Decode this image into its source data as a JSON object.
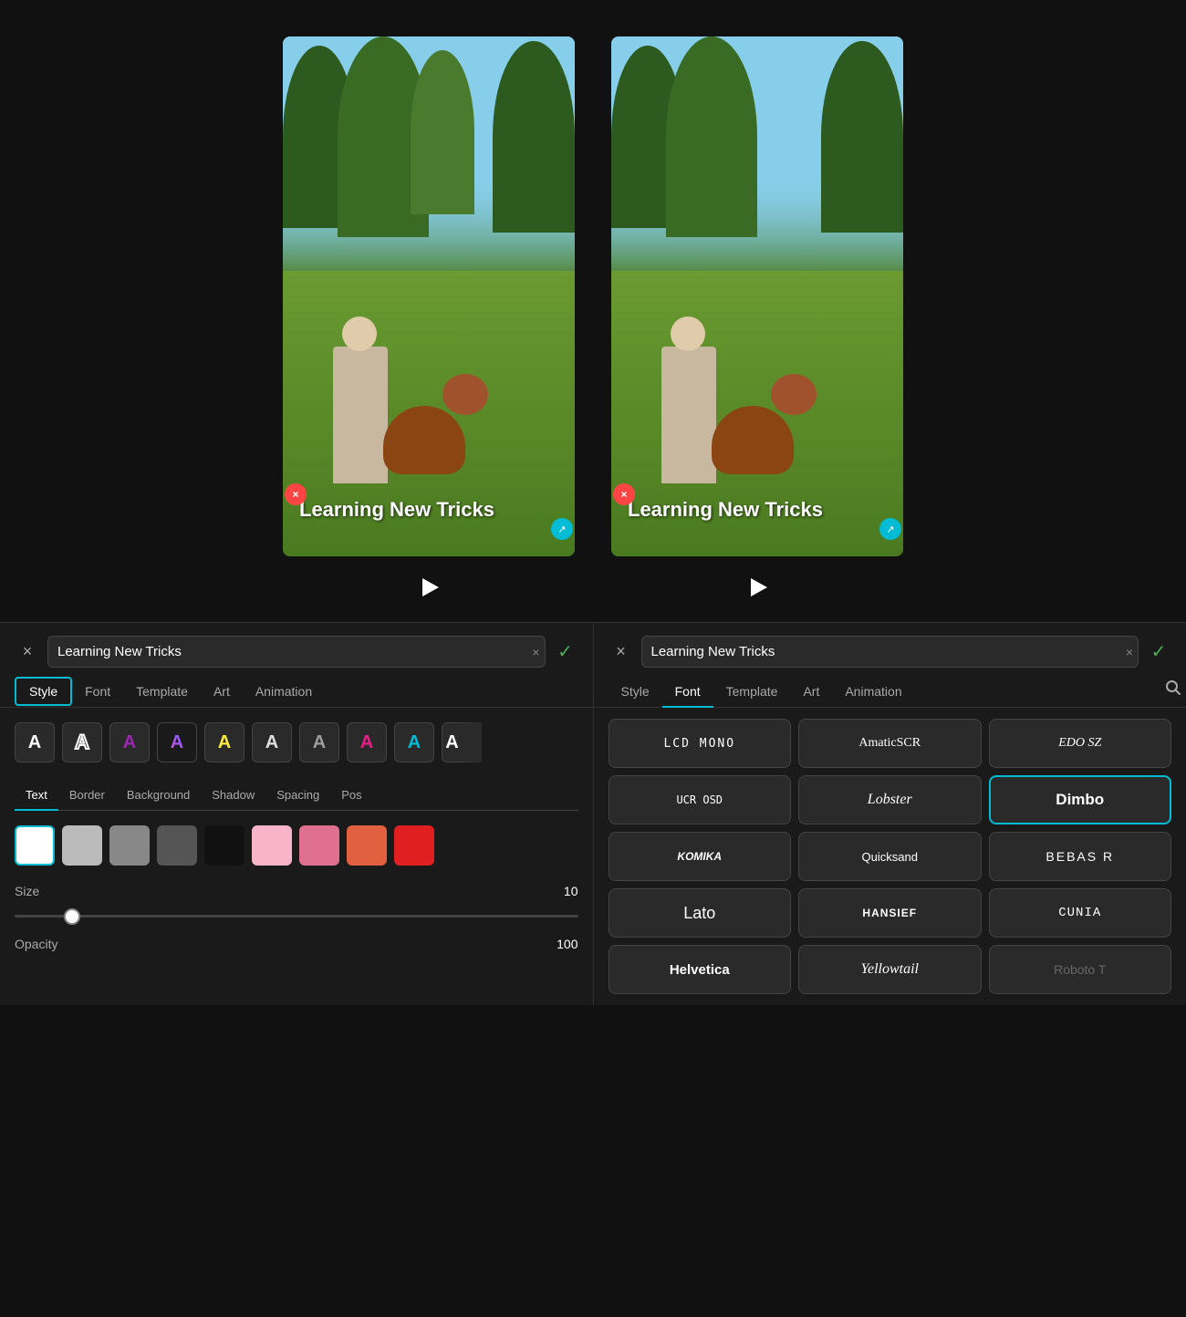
{
  "previews": [
    {
      "caption": "Learning New Tricks",
      "play_label": "play"
    },
    {
      "caption": "Learning New Tricks",
      "play_label": "play"
    }
  ],
  "left_panel": {
    "close_label": "×",
    "input_value": "Learning New Tricks",
    "input_clear": "×",
    "confirm_label": "✓",
    "tabs": [
      {
        "id": "style",
        "label": "Style",
        "active": true
      },
      {
        "id": "font",
        "label": "Font",
        "active": false
      },
      {
        "id": "template",
        "label": "Template",
        "active": false
      },
      {
        "id": "art",
        "label": "Art",
        "active": false
      },
      {
        "id": "animation",
        "label": "Animation",
        "active": false
      }
    ],
    "text_style_icons": [
      {
        "label": "A",
        "style": "plain"
      },
      {
        "label": "A",
        "style": "outline"
      },
      {
        "label": "A",
        "style": "purple"
      },
      {
        "label": "A",
        "style": "multi"
      },
      {
        "label": "A",
        "style": "yellow"
      },
      {
        "label": "A",
        "style": "white2"
      },
      {
        "label": "A",
        "style": "gray"
      },
      {
        "label": "A",
        "style": "pink"
      },
      {
        "label": "A",
        "style": "cyan"
      },
      {
        "label": "A",
        "style": "partial"
      }
    ],
    "style_subtabs": [
      "Text",
      "Border",
      "Background",
      "Shadow",
      "Spacing",
      "Pos"
    ],
    "active_subtab": "Text",
    "colors": [
      {
        "color": "#ffffff",
        "selected": true
      },
      {
        "color": "#bbbbbb",
        "selected": false
      },
      {
        "color": "#888888",
        "selected": false
      },
      {
        "color": "#555555",
        "selected": false
      },
      {
        "color": "#111111",
        "selected": false
      },
      {
        "color": "#f8b4c8",
        "selected": false
      },
      {
        "color": "#e07090",
        "selected": false
      },
      {
        "color": "#e06040",
        "selected": false
      },
      {
        "color": "#e02020",
        "selected": false
      }
    ],
    "size_label": "Size",
    "size_value": "10",
    "size_slider_value": 10,
    "opacity_label": "Opacity",
    "opacity_value": "100"
  },
  "right_panel": {
    "close_label": "×",
    "input_value": "Learning New Tricks",
    "input_clear": "×",
    "confirm_label": "✓",
    "search_icon": "🔍",
    "tabs": [
      {
        "id": "style",
        "label": "Style",
        "active": false
      },
      {
        "id": "font",
        "label": "Font",
        "active": true
      },
      {
        "id": "template",
        "label": "Template",
        "active": false
      },
      {
        "id": "art",
        "label": "Art",
        "active": false
      },
      {
        "id": "animation",
        "label": "Animation",
        "active": false
      }
    ],
    "fonts": [
      {
        "id": "lcd-mono",
        "label": "LCD MONO",
        "style": "font-lcd",
        "selected": false
      },
      {
        "id": "amatic-sc",
        "label": "AmaticSCR",
        "style": "font-amatic",
        "selected": false
      },
      {
        "id": "edo-sz",
        "label": "EDO SZ",
        "style": "font-edo",
        "selected": false
      },
      {
        "id": "ucr-osd",
        "label": "UCR OSD",
        "style": "font-ucr",
        "selected": false
      },
      {
        "id": "lobster",
        "label": "Lobster",
        "style": "font-lobster",
        "selected": false
      },
      {
        "id": "dimbo",
        "label": "Dimbo",
        "style": "font-dimbo",
        "selected": true
      },
      {
        "id": "komika",
        "label": "KOMIKA",
        "style": "font-komika",
        "selected": false
      },
      {
        "id": "quicksand",
        "label": "Quicksand",
        "style": "font-quicksand",
        "selected": false
      },
      {
        "id": "bebas-r",
        "label": "BEBAS R",
        "style": "font-bebas",
        "selected": false
      },
      {
        "id": "lato",
        "label": "Lato",
        "style": "font-lato",
        "selected": false
      },
      {
        "id": "hansief",
        "label": "HANSIEF",
        "style": "font-hansief",
        "selected": false
      },
      {
        "id": "cunia",
        "label": "CUNIA",
        "style": "font-cunia",
        "selected": false
      },
      {
        "id": "helvetica",
        "label": "Helvetica",
        "style": "font-helvetica",
        "selected": false
      },
      {
        "id": "yellowtail",
        "label": "Yellowtail",
        "style": "font-yellowtail",
        "selected": false
      },
      {
        "id": "roboto-t",
        "label": "Roboto T",
        "style": "font-roboto grayed",
        "selected": false
      }
    ]
  }
}
